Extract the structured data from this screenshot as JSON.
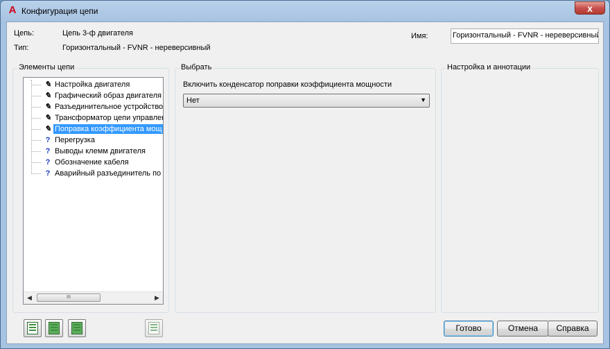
{
  "window": {
    "title": "Конфигурация цепи",
    "app_icon": "A",
    "close_glyph": "x"
  },
  "header": {
    "circuit_label": "Цепь:",
    "circuit_value": "Цепь 3-ф двигателя",
    "type_label": "Тип:",
    "type_value": "Горизонтальный - FVNR - нереверсивный",
    "name_label": "Имя:",
    "name_value": "Горизонтальный - FVNR - нереверсивный"
  },
  "groups": {
    "elements_title": "Элементы цепи",
    "select_title": "Выбрать",
    "settings_title": "Настройка и аннотации"
  },
  "tree": {
    "items": [
      {
        "label": "Настройка двигателя",
        "icon": "pencil-icon",
        "glyph": "✎",
        "selected": false
      },
      {
        "label": "Графический образ двигателя",
        "icon": "pencil-icon",
        "glyph": "✎",
        "selected": false
      },
      {
        "label": "Разъединительное устройство",
        "icon": "pencil-icon",
        "glyph": "✎",
        "selected": false
      },
      {
        "label": "Трансформатор цепи управлен",
        "icon": "pencil-icon",
        "glyph": "✎",
        "selected": false
      },
      {
        "label": "Поправка коэффициента мощ",
        "icon": "pencil-icon",
        "glyph": "✎",
        "selected": true
      },
      {
        "label": "Перегрузка",
        "icon": "question-icon",
        "glyph": "?",
        "selected": false
      },
      {
        "label": "Выводы клемм двигателя",
        "icon": "question-icon",
        "glyph": "?",
        "selected": false
      },
      {
        "label": "Обозначение кабеля",
        "icon": "question-icon",
        "glyph": "?",
        "selected": false
      },
      {
        "label": "Аварийный разъединитель по",
        "icon": "question-icon",
        "glyph": "?",
        "selected": false
      }
    ],
    "scroll_left": "◀",
    "scroll_right": "▶",
    "scroll_thumb": "III"
  },
  "select_panel": {
    "prompt": "Включить конденсатор поправки коэффициента мощности",
    "selected_option": "Нет",
    "arrow": "▼"
  },
  "footer": {
    "ok_label": "Готово",
    "cancel_label": "Отмена",
    "help_label": "Справка"
  },
  "colors": {
    "selection": "#3399ff",
    "titlebar": "#b9d1ea",
    "close_button": "#c75050"
  }
}
